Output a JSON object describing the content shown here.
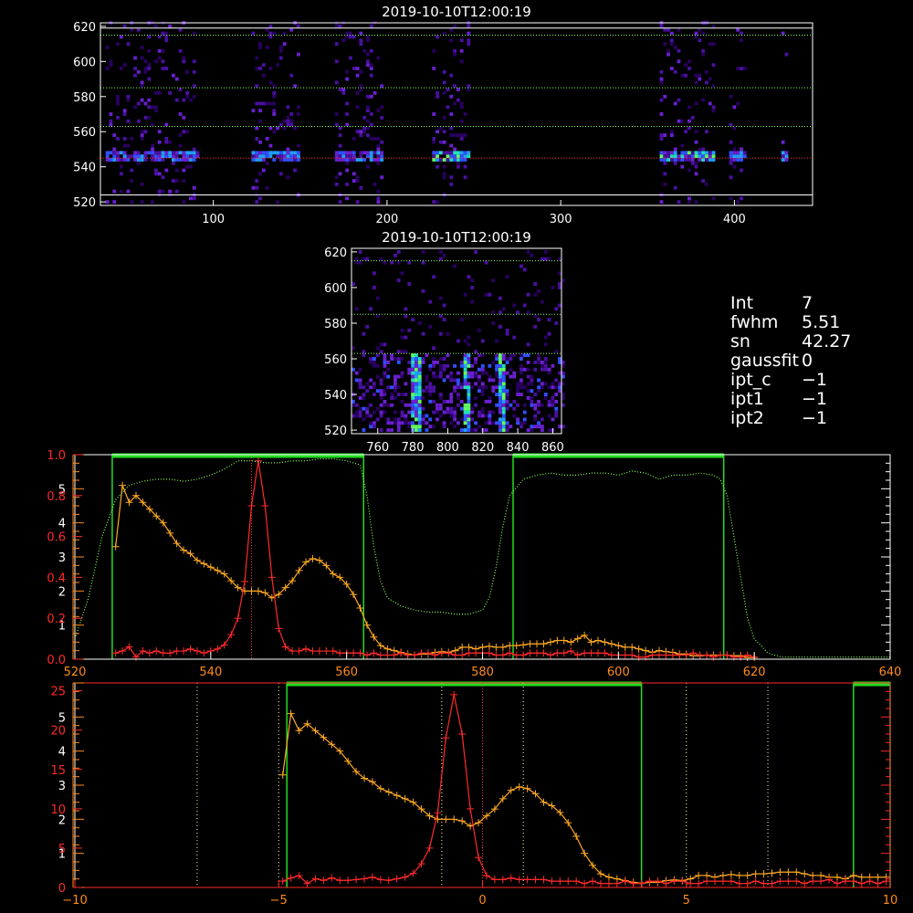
{
  "colors": {
    "bg": "#000000",
    "axis_white": "#ffffff",
    "axis_orange": "#ff8c1a",
    "axis_red": "#ff2a2a",
    "green": "#22dd22",
    "line_red": "#ff2a2a",
    "line_orange": "#ffaa22",
    "dotted_green": "#88ff55",
    "dotted_red": "#ff3333",
    "dotted_white": "#ffffaa"
  },
  "info_panel": [
    {
      "key": "Int",
      "value": "7"
    },
    {
      "key": "fwhm",
      "value": "5.51"
    },
    {
      "key": "sn",
      "value": "42.27"
    },
    {
      "key": "gaussfit",
      "value": "0"
    },
    {
      "key": "ipt_c",
      "value": "−1"
    },
    {
      "key": "ipt1",
      "value": "−1"
    },
    {
      "key": "ipt2",
      "value": "−1"
    }
  ],
  "chart_data": [
    {
      "type": "heatmap",
      "title": "2019-10-10T12:00:19",
      "xlim": [
        35,
        445
      ],
      "ylim": [
        518,
        622
      ],
      "x_ticks": [
        "100",
        "200",
        "300",
        "400"
      ],
      "x_tick_values": [
        100,
        200,
        300,
        400
      ],
      "y_ticks": [
        "520",
        "540",
        "560",
        "580",
        "600",
        "620"
      ],
      "y_tick_values": [
        520,
        540,
        560,
        580,
        600,
        620
      ],
      "guide_lines_y": [
        524,
        545,
        563,
        585,
        615,
        619
      ],
      "column_bands": [
        [
          38,
          90
        ],
        [
          122,
          148
        ],
        [
          170,
          197
        ],
        [
          226,
          246
        ],
        [
          357,
          388
        ],
        [
          397,
          406
        ],
        [
          427,
          430
        ]
      ],
      "bright_row": 545
    },
    {
      "type": "heatmap",
      "title": "2019-10-10T12:00:19",
      "xlim": [
        745,
        865
      ],
      "ylim": [
        518,
        622
      ],
      "x_ticks": [
        "760",
        "780",
        "800",
        "820",
        "840",
        "860"
      ],
      "x_tick_values": [
        760,
        780,
        800,
        820,
        840,
        860
      ],
      "y_ticks": [
        "520",
        "540",
        "560",
        "580",
        "600",
        "620"
      ],
      "y_tick_values": [
        520,
        540,
        560,
        580,
        600,
        620
      ],
      "guide_lines_y": [
        563,
        585,
        615
      ],
      "bright_columns": [
        781,
        810,
        830
      ]
    },
    {
      "type": "line",
      "xlim": [
        520,
        640
      ],
      "x_ticks": [
        "520",
        "540",
        "560",
        "580",
        "600",
        "620",
        "640"
      ],
      "x_tick_values": [
        520,
        540,
        560,
        580,
        600,
        620,
        640
      ],
      "left_axis_orange": {
        "ylim": [
          0,
          6
        ],
        "ticks": [
          "1",
          "2",
          "3",
          "4",
          "5"
        ],
        "tick_values": [
          1,
          2,
          3,
          4,
          5
        ]
      },
      "left_axis_red": {
        "ylim": [
          0,
          1.0
        ],
        "ticks": [
          "0.0",
          "0.2",
          "0.4",
          "0.6",
          "0.8",
          "1.0"
        ],
        "tick_values": [
          0.0,
          0.2,
          0.4,
          0.6,
          0.8,
          1.0
        ]
      },
      "green_boxes": [
        [
          525.5,
          562.5
        ],
        [
          584.5,
          615.5
        ]
      ],
      "vline": 546,
      "series": [
        {
          "color": "orange",
          "x": [
            526,
            527,
            528,
            529,
            530,
            531,
            532,
            533,
            534,
            535,
            536,
            537,
            538,
            539,
            540,
            541,
            542,
            543,
            544,
            545,
            546,
            547,
            548,
            549,
            550,
            551,
            552,
            553,
            554,
            555,
            556,
            557,
            558,
            559,
            560,
            561,
            562,
            563,
            564,
            565,
            566,
            567,
            568,
            569,
            570,
            571,
            572,
            573,
            574,
            575,
            576,
            577,
            578,
            579,
            580,
            581,
            582,
            583,
            584,
            585,
            586,
            587,
            588,
            589,
            590,
            591,
            592,
            593,
            594,
            595,
            596,
            597,
            598,
            599,
            600,
            601,
            602,
            603,
            604,
            605,
            606,
            607,
            608,
            609,
            610,
            611,
            612,
            613,
            614,
            615,
            616,
            617,
            618,
            619,
            620
          ],
          "y": [
            3.3,
            5.1,
            4.6,
            4.8,
            4.6,
            4.4,
            4.2,
            4.0,
            3.7,
            3.4,
            3.2,
            3.1,
            2.9,
            2.8,
            2.7,
            2.6,
            2.5,
            2.3,
            2.1,
            2.0,
            2.0,
            2.0,
            1.95,
            1.8,
            1.9,
            2.1,
            2.3,
            2.6,
            2.85,
            2.95,
            2.9,
            2.75,
            2.5,
            2.4,
            2.2,
            1.9,
            1.5,
            1.0,
            0.65,
            0.4,
            0.3,
            0.25,
            0.2,
            0.15,
            0.12,
            0.15,
            0.15,
            0.2,
            0.22,
            0.2,
            0.25,
            0.35,
            0.35,
            0.3,
            0.35,
            0.38,
            0.35,
            0.35,
            0.4,
            0.4,
            0.42,
            0.45,
            0.45,
            0.45,
            0.5,
            0.55,
            0.55,
            0.5,
            0.6,
            0.7,
            0.5,
            0.55,
            0.5,
            0.45,
            0.4,
            0.35,
            0.35,
            0.3,
            0.25,
            0.2,
            0.25,
            0.22,
            0.2,
            0.15,
            0.15,
            0.1,
            0.1,
            0.12,
            0.12,
            0.12,
            0.12,
            0.1,
            0.1,
            0.05,
            0.05
          ]
        },
        {
          "color": "red",
          "x": [
            526,
            527,
            528,
            529,
            530,
            531,
            532,
            533,
            534,
            535,
            536,
            537,
            538,
            539,
            540,
            541,
            542,
            543,
            544,
            545,
            546,
            547,
            548,
            549,
            550,
            551,
            552,
            553,
            554,
            555,
            556,
            557,
            558,
            559,
            560,
            561,
            562,
            563,
            564,
            565,
            566,
            567,
            568,
            569,
            570,
            571,
            572,
            573,
            574,
            575,
            576,
            577,
            578,
            579,
            580,
            581,
            582,
            583,
            584,
            585,
            586,
            587,
            588,
            589,
            590,
            591,
            592,
            593,
            594,
            595,
            596,
            597,
            598,
            599,
            600,
            601,
            602,
            603,
            604,
            605,
            606,
            607,
            608,
            609,
            610,
            611,
            612,
            613,
            614,
            615,
            616,
            617,
            618,
            619,
            620
          ],
          "y": [
            0.03,
            0.04,
            0.06,
            0.01,
            0.04,
            0.03,
            0.04,
            0.03,
            0.03,
            0.04,
            0.04,
            0.05,
            0.04,
            0.03,
            0.04,
            0.05,
            0.07,
            0.12,
            0.2,
            0.38,
            0.75,
            0.97,
            0.75,
            0.4,
            0.15,
            0.06,
            0.04,
            0.04,
            0.05,
            0.04,
            0.04,
            0.04,
            0.04,
            0.03,
            0.03,
            0.03,
            0.03,
            0.02,
            0.03,
            0.02,
            0.02,
            0.02,
            0.03,
            0.02,
            0.02,
            0.03,
            0.03,
            0.02,
            0.03,
            0.03,
            0.02,
            0.02,
            0.03,
            0.03,
            0.03,
            0.03,
            0.02,
            0.02,
            0.03,
            0.02,
            0.02,
            0.03,
            0.03,
            0.03,
            0.02,
            0.03,
            0.03,
            0.04,
            0.02,
            0.03,
            0.03,
            0.03,
            0.03,
            0.02,
            0.02,
            0.02,
            0.02,
            0.01,
            0.01,
            0.02,
            0.02,
            0.02,
            0.02,
            0.02,
            0.02,
            0.03,
            0.02,
            0.02,
            0.01,
            0.02,
            0.02,
            0.01,
            0.01,
            0.02,
            0.01
          ]
        },
        {
          "color": "green-dotted",
          "x": [
            520,
            522,
            524,
            526,
            528,
            530,
            532,
            534,
            536,
            538,
            540,
            542,
            544,
            546,
            548,
            550,
            552,
            554,
            556,
            558,
            560,
            562,
            563,
            564,
            565,
            566,
            568,
            570,
            572,
            574,
            576,
            578,
            580,
            581,
            582,
            583,
            584,
            586,
            588,
            590,
            592,
            594,
            596,
            598,
            600,
            602,
            604,
            606,
            608,
            610,
            612,
            614,
            615,
            616,
            617,
            618,
            619,
            620,
            622,
            624,
            626,
            628,
            630,
            632,
            634,
            636,
            638,
            640
          ],
          "y": [
            0.1,
            0.3,
            0.6,
            0.78,
            0.85,
            0.87,
            0.88,
            0.88,
            0.87,
            0.88,
            0.9,
            0.93,
            0.97,
            0.97,
            0.96,
            0.96,
            0.97,
            0.97,
            0.98,
            0.98,
            0.97,
            0.95,
            0.8,
            0.55,
            0.38,
            0.3,
            0.26,
            0.24,
            0.23,
            0.23,
            0.22,
            0.22,
            0.24,
            0.3,
            0.45,
            0.65,
            0.8,
            0.88,
            0.9,
            0.91,
            0.9,
            0.9,
            0.91,
            0.91,
            0.9,
            0.92,
            0.91,
            0.88,
            0.9,
            0.9,
            0.91,
            0.9,
            0.88,
            0.8,
            0.6,
            0.4,
            0.2,
            0.1,
            0.03,
            0.01,
            0.01,
            0.01,
            0.01,
            0.01,
            0.01,
            0.01,
            0.01,
            0.01
          ]
        }
      ]
    },
    {
      "type": "line",
      "xlim": [
        -10,
        10
      ],
      "x_ticks": [
        "−10",
        "−5",
        "0",
        "5",
        "10"
      ],
      "x_tick_values": [
        -10,
        -5,
        0,
        5,
        10
      ],
      "left_axis_orange": {
        "ylim": [
          0,
          6
        ],
        "ticks": [
          "1",
          "2",
          "3",
          "4",
          "5"
        ],
        "tick_values": [
          1,
          2,
          3,
          4,
          5
        ]
      },
      "left_axis_red": {
        "ylim": [
          0,
          26
        ],
        "ticks": [
          "0",
          "5",
          "10",
          "15",
          "20",
          "25"
        ],
        "tick_values": [
          0,
          5,
          10,
          15,
          20,
          25
        ]
      },
      "green_boxes": [
        [
          -4.8,
          3.9
        ],
        [
          9.1,
          10
        ]
      ],
      "dotted_vlines": [
        -7,
        -5,
        -1,
        1,
        5,
        7
      ],
      "vline": 0,
      "series": [
        {
          "color": "orange",
          "x": [
            -4.9,
            -4.7,
            -4.5,
            -4.3,
            -4.1,
            -3.9,
            -3.7,
            -3.5,
            -3.3,
            -3.1,
            -2.9,
            -2.7,
            -2.5,
            -2.3,
            -2.1,
            -1.9,
            -1.7,
            -1.5,
            -1.3,
            -1.1,
            -0.9,
            -0.7,
            -0.5,
            -0.3,
            -0.1,
            0.1,
            0.3,
            0.5,
            0.7,
            0.9,
            1.1,
            1.3,
            1.5,
            1.7,
            1.9,
            2.1,
            2.3,
            2.5,
            2.7,
            2.9,
            3.1,
            3.3,
            3.5,
            3.7,
            3.9,
            4.1,
            4.3,
            4.5,
            4.7,
            4.9,
            5.1,
            5.3,
            5.5,
            5.7,
            5.9,
            6.1,
            6.3,
            6.5,
            6.7,
            6.9,
            7.1,
            7.3,
            7.5,
            7.7,
            7.9,
            8.1,
            8.3,
            8.5,
            8.7,
            8.9,
            9.1,
            9.3,
            9.5,
            9.7,
            9.9
          ],
          "y": [
            3.3,
            5.1,
            4.6,
            4.8,
            4.6,
            4.4,
            4.2,
            4.0,
            3.7,
            3.4,
            3.2,
            3.1,
            2.9,
            2.8,
            2.7,
            2.6,
            2.5,
            2.3,
            2.1,
            2.0,
            2.0,
            2.0,
            1.95,
            1.8,
            1.9,
            2.1,
            2.3,
            2.6,
            2.85,
            2.95,
            2.9,
            2.75,
            2.5,
            2.4,
            2.2,
            1.9,
            1.5,
            1.0,
            0.65,
            0.4,
            0.3,
            0.25,
            0.2,
            0.15,
            0.12,
            0.15,
            0.15,
            0.2,
            0.22,
            0.2,
            0.25,
            0.35,
            0.35,
            0.3,
            0.35,
            0.38,
            0.35,
            0.35,
            0.4,
            0.4,
            0.42,
            0.45,
            0.45,
            0.45,
            0.4,
            0.35,
            0.35,
            0.3,
            0.3,
            0.25,
            0.35,
            0.3,
            0.3,
            0.3,
            0.3
          ]
        },
        {
          "color": "red",
          "x": [
            -4.9,
            -4.7,
            -4.5,
            -4.3,
            -4.1,
            -3.9,
            -3.7,
            -3.5,
            -3.3,
            -3.1,
            -2.9,
            -2.7,
            -2.5,
            -2.3,
            -2.1,
            -1.9,
            -1.7,
            -1.5,
            -1.3,
            -1.1,
            -0.9,
            -0.7,
            -0.5,
            -0.3,
            -0.1,
            0.1,
            0.3,
            0.5,
            0.7,
            0.9,
            1.1,
            1.3,
            1.5,
            1.7,
            1.9,
            2.1,
            2.3,
            2.5,
            2.7,
            2.9,
            3.1,
            3.3,
            3.5,
            3.7,
            3.9,
            4.1,
            4.3,
            4.5,
            4.7,
            4.9,
            5.1,
            5.3,
            5.5,
            5.7,
            5.9,
            6.1,
            6.3,
            6.5,
            6.7,
            6.9,
            7.1,
            7.3,
            7.5,
            7.7,
            7.9,
            8.1,
            8.3,
            8.5,
            8.7,
            8.9,
            9.1,
            9.3,
            9.5,
            9.7,
            9.9
          ],
          "y": [
            0.8,
            1.2,
            1.5,
            0.5,
            1.1,
            0.9,
            1.2,
            0.9,
            0.9,
            1.0,
            1.1,
            1.3,
            1.0,
            0.9,
            1.1,
            1.3,
            1.8,
            3.0,
            5.0,
            9.5,
            19.0,
            24.5,
            19.5,
            10.0,
            3.8,
            1.5,
            1.0,
            1.0,
            1.2,
            1.0,
            1.0,
            1.0,
            1.0,
            0.8,
            0.8,
            0.8,
            0.8,
            0.5,
            0.8,
            0.5,
            0.5,
            0.5,
            0.8,
            0.5,
            0.5,
            0.8,
            0.8,
            0.5,
            0.8,
            0.8,
            0.5,
            0.5,
            0.8,
            0.8,
            0.8,
            0.8,
            0.5,
            0.5,
            0.8,
            0.5,
            0.5,
            0.8,
            0.8,
            0.8,
            0.5,
            0.8,
            0.8,
            1.0,
            0.5,
            0.8,
            0.8,
            0.5,
            0.8,
            0.5,
            0.8
          ]
        }
      ]
    }
  ]
}
